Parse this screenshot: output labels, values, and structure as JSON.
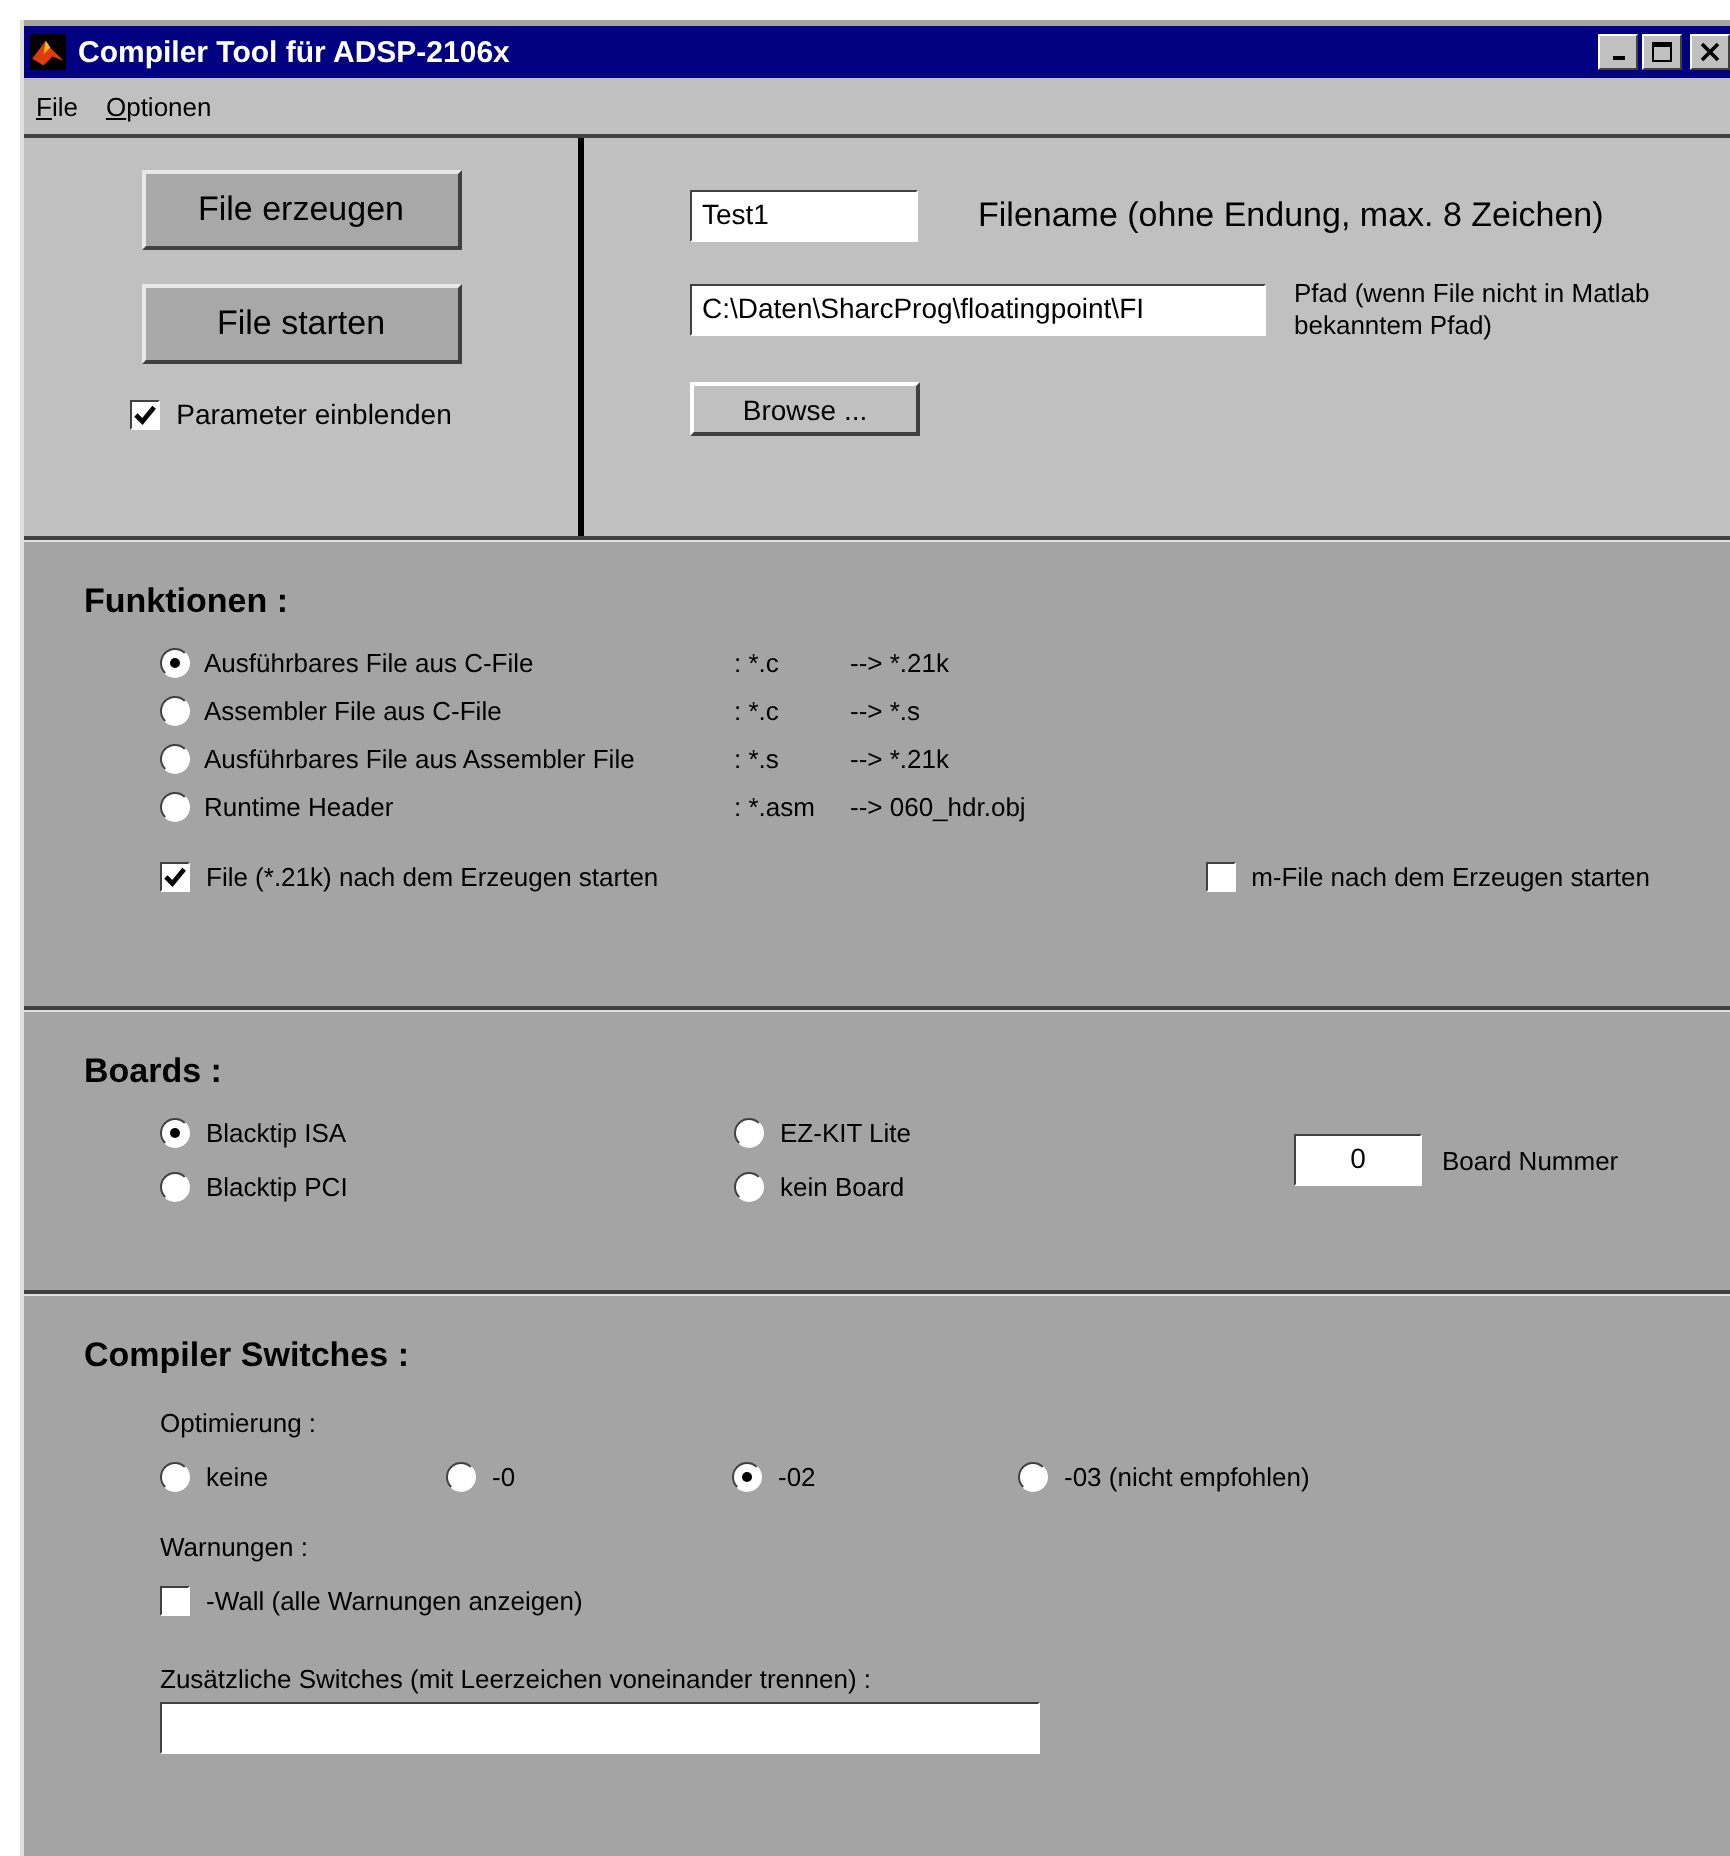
{
  "window": {
    "title": "Compiler Tool für ADSP-2106x"
  },
  "menu": [
    "File",
    "Optionen"
  ],
  "top": {
    "buttons": [
      "File erzeugen",
      "File starten"
    ],
    "show_params": {
      "label": "Parameter einblenden",
      "checked": true
    },
    "filename": {
      "value": "Test1",
      "label": "Filename (ohne Endung, max. 8 Zeichen)"
    },
    "path": {
      "value": "C:\\Daten\\SharcProg\\floatingpoint\\FI",
      "label": "Pfad (wenn File nicht in Matlab bekanntem Pfad)"
    },
    "browse": "Browse ..."
  },
  "funktionen": {
    "title": "Funktionen :",
    "options": [
      {
        "label": "Ausführbares File aus C-File",
        "source": ": *.c",
        "target": "--> *.21k",
        "selected": true
      },
      {
        "label": "Assembler File aus C-File",
        "source": ": *.c",
        "target": "--> *.s",
        "selected": false
      },
      {
        "label": "Ausführbares File aus Assembler File",
        "source": ": *.s",
        "target": "--> *.21k",
        "selected": false
      },
      {
        "label": "Runtime Header",
        "source": ": *.asm",
        "target": "--> 060_hdr.obj",
        "selected": false
      }
    ],
    "checks": [
      {
        "label": "File (*.21k) nach dem Erzeugen starten",
        "checked": true
      },
      {
        "label": "m-File nach dem Erzeugen starten",
        "checked": false
      }
    ]
  },
  "boards": {
    "title": "Boards :",
    "options": [
      {
        "label": "Blacktip ISA",
        "selected": true
      },
      {
        "label": "EZ-KIT Lite",
        "selected": false
      },
      {
        "label": "Blacktip PCI",
        "selected": false
      },
      {
        "label": "kein Board",
        "selected": false
      }
    ],
    "board_number": {
      "value": "0",
      "label": "Board Nummer"
    }
  },
  "switches": {
    "title": "Compiler Switches :",
    "optimization_label": "Optimierung :",
    "optimization": [
      {
        "label": "keine",
        "selected": false
      },
      {
        "label": "-0",
        "selected": false
      },
      {
        "label": "-02",
        "selected": true
      },
      {
        "label": "-03 (nicht empfohlen)",
        "selected": false
      }
    ],
    "warnings_label": "Warnungen :",
    "wall": {
      "label": "-Wall (alle Warnungen anzeigen)",
      "checked": false
    },
    "extra_label": "Zusätzliche Switches (mit Leerzeichen voneinander trennen) :"
  }
}
